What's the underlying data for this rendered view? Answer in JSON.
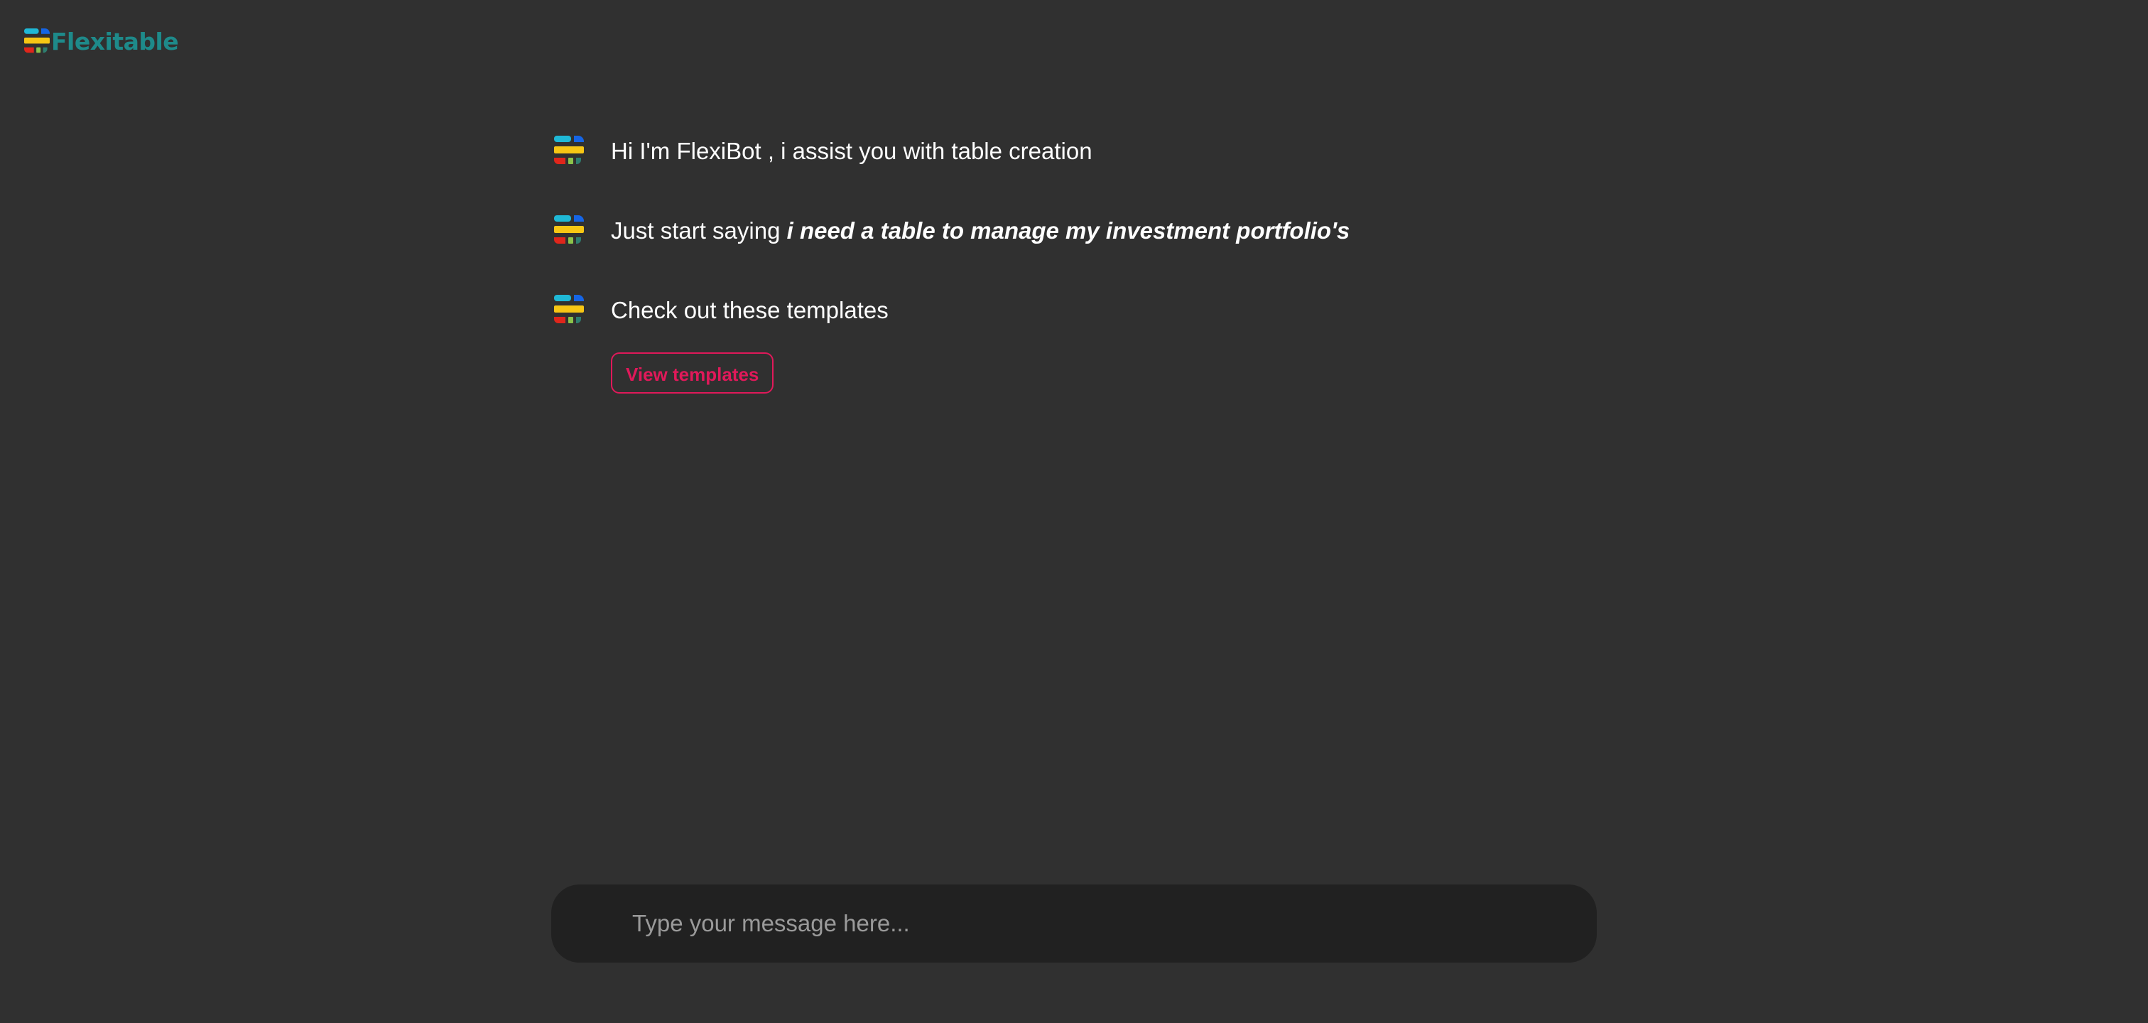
{
  "brand": {
    "name": "Flexitable",
    "logo_icon": "flexitable-logo-icon",
    "color": "#1e8a8a"
  },
  "messages": [
    {
      "avatar": "flexibot-avatar-icon",
      "text": "Hi I'm FlexiBot , i assist you with table creation"
    },
    {
      "avatar": "flexibot-avatar-icon",
      "text": "Just start saying ",
      "emphasis": "i need a table to manage my investment portfolio's"
    },
    {
      "avatar": "flexibot-avatar-icon",
      "text": "Check out these templates"
    }
  ],
  "actions": {
    "view_templates_label": "View templates",
    "accent": "#e0195a"
  },
  "composer": {
    "placeholder": "Type your message here...",
    "value": ""
  },
  "colors": {
    "background": "#303030",
    "composer_background": "#212121"
  }
}
